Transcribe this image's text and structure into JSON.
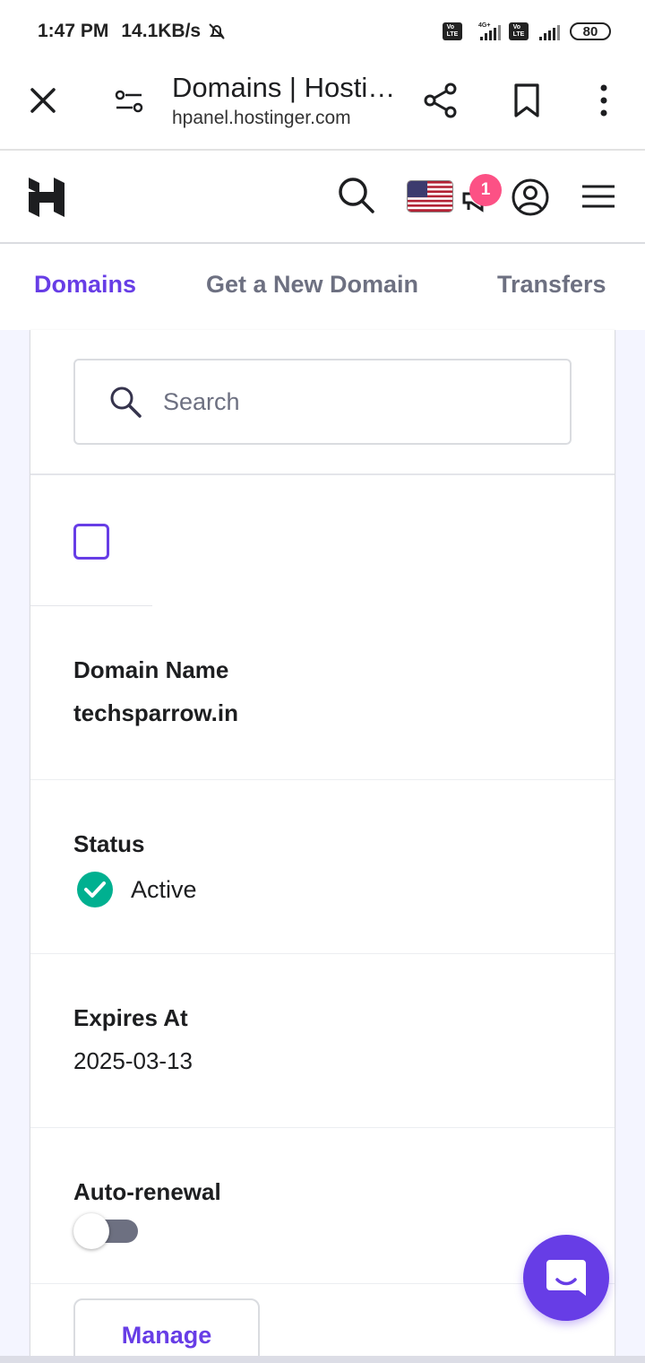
{
  "status_bar": {
    "time": "1:47 PM",
    "net_speed": "14.1KB/s",
    "network": "4G+",
    "battery": "80"
  },
  "browser": {
    "page_title": "Domains | Hosti…",
    "url": "hpanel.hostinger.com"
  },
  "header": {
    "notification_count": "1"
  },
  "tabs": [
    {
      "label": "Domains",
      "active": true
    },
    {
      "label": "Get a New Domain",
      "active": false
    },
    {
      "label": "Transfers",
      "active": false
    }
  ],
  "search": {
    "placeholder": "Search",
    "value": ""
  },
  "domain": {
    "name_label": "Domain Name",
    "name_value": "techsparrow.in",
    "status_label": "Status",
    "status_value": "Active",
    "expires_label": "Expires At",
    "expires_value": "2025-03-13",
    "autorenew_label": "Auto-renewal",
    "autorenew_on": false
  },
  "actions": {
    "manage_label": "Manage"
  },
  "colors": {
    "accent": "#673de6",
    "success": "#00b090",
    "badge": "#fc5185",
    "muted": "#6d7081"
  }
}
